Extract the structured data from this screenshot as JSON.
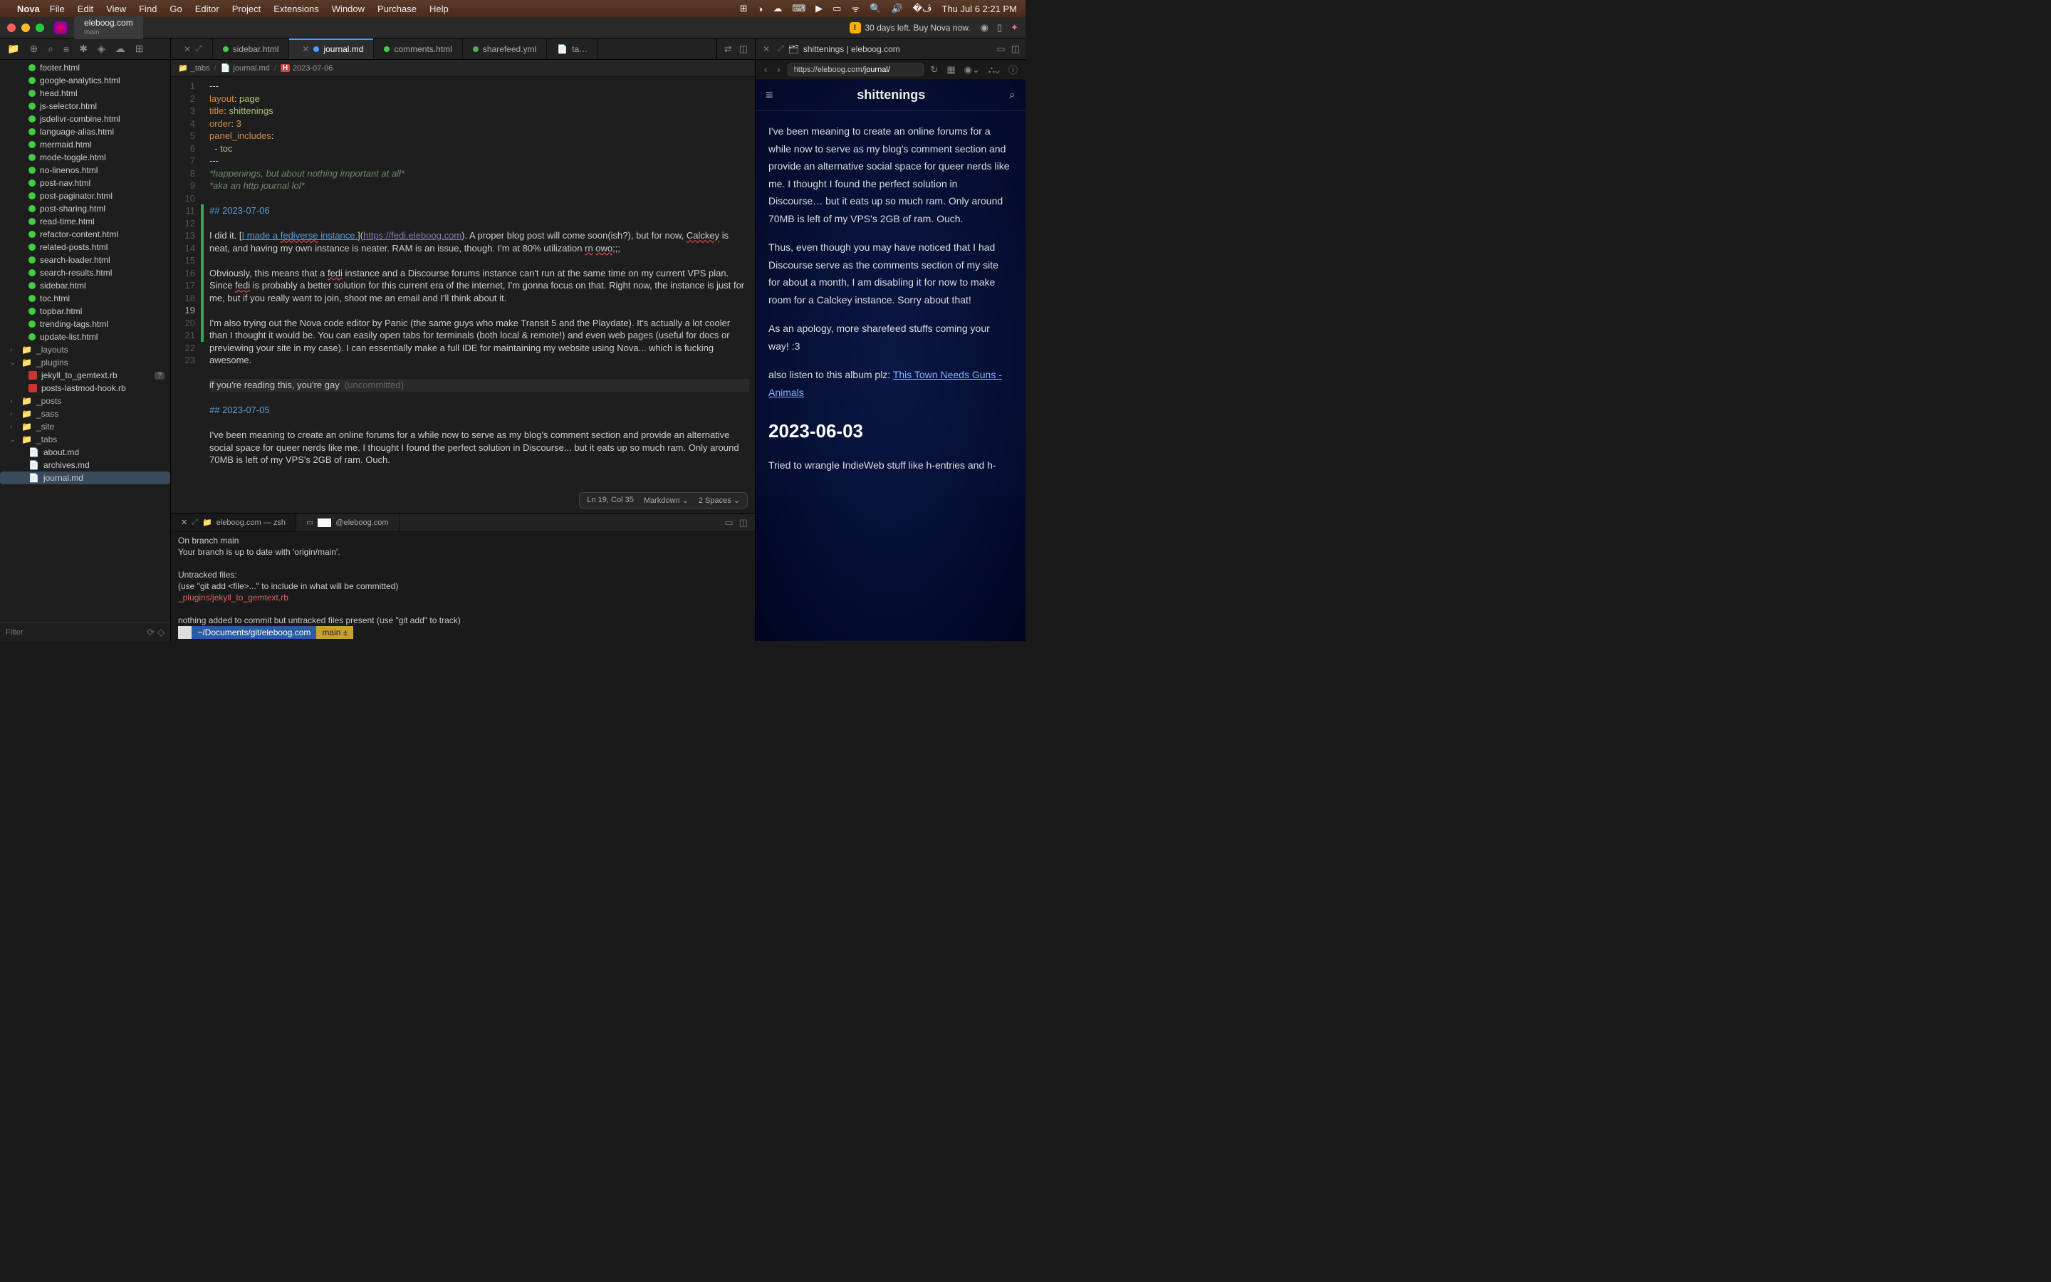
{
  "menubar": {
    "app": "Nova",
    "items": [
      "File",
      "Edit",
      "View",
      "Find",
      "Go",
      "Editor",
      "Project",
      "Extensions",
      "Window",
      "Purchase",
      "Help"
    ],
    "clock": "Thu Jul 6  2:21 PM"
  },
  "titlebar": {
    "project": "eleboog.com",
    "branch": "main",
    "trial": "30 days left. Buy Nova now."
  },
  "tabs": [
    {
      "label": "sidebar.html",
      "icon": "green"
    },
    {
      "label": "journal.md",
      "icon": "blue",
      "active": true,
      "close": true
    },
    {
      "label": "comments.html",
      "icon": "green"
    },
    {
      "label": "sharefeed.yml",
      "icon": "green-alt"
    },
    {
      "label": "ta…",
      "icon": "doc"
    }
  ],
  "preview_tab": {
    "label": "shittenings | eleboog.com"
  },
  "breadcrumb": {
    "segs": [
      "_tabs",
      "journal.md"
    ],
    "heading": "2023-07-06"
  },
  "sidebar_files": [
    "footer.html",
    "google-analytics.html",
    "head.html",
    "js-selector.html",
    "jsdelivr-combine.html",
    "language-alias.html",
    "mermaid.html",
    "mode-toggle.html",
    "no-linenos.html",
    "post-nav.html",
    "post-paginator.html",
    "post-sharing.html",
    "read-time.html",
    "refactor-content.html",
    "related-posts.html",
    "search-loader.html",
    "search-results.html",
    "sidebar.html",
    "toc.html",
    "topbar.html",
    "trending-tags.html",
    "update-list.html"
  ],
  "sidebar_folders": [
    {
      "name": "_layouts",
      "open": false
    },
    {
      "name": "_plugins",
      "open": true,
      "children": [
        {
          "name": "jekyll_to_gemtext.rb",
          "badge": "?"
        },
        {
          "name": "posts-lastmod-hook.rb"
        }
      ]
    },
    {
      "name": "_posts",
      "open": false
    },
    {
      "name": "_sass",
      "open": false
    },
    {
      "name": "_site",
      "open": false
    },
    {
      "name": "_tabs",
      "open": true,
      "children": [
        {
          "name": "about.md"
        },
        {
          "name": "archives.md"
        },
        {
          "name": "journal.md",
          "selected": true
        }
      ]
    }
  ],
  "filter_placeholder": "Filter",
  "editor": {
    "lines": [
      {
        "n": 1,
        "html": "---"
      },
      {
        "n": 2,
        "html": "<span class='kw'>layout</span>: <span class='str'>page</span>"
      },
      {
        "n": 3,
        "html": "<span class='kw'>title</span>: <span class='str'>shittenings</span>"
      },
      {
        "n": 4,
        "html": "<span class='kw'>order</span>: <span class='num'>3</span>"
      },
      {
        "n": 5,
        "html": "<span class='kw'>panel_includes</span>:"
      },
      {
        "n": 6,
        "html": "  - <span class='str'>toc</span>"
      },
      {
        "n": 7,
        "html": "---"
      },
      {
        "n": 8,
        "html": "<span class='cmt'>*happenings, but about nothing important at all*</span>"
      },
      {
        "n": 9,
        "html": "<span class='cmt'>*aka an http journal lol*</span>"
      },
      {
        "n": 10,
        "html": ""
      },
      {
        "n": 11,
        "html": "<span class='hdr'>## 2023-07-06</span>",
        "mod": true
      },
      {
        "n": 12,
        "html": "",
        "mod": true
      },
      {
        "n": 13,
        "html": "I did it. [<span class='lnk'>I made a <span class='spell'>fediverse</span> instance.</span>](<span class='url'>https://fedi.eleboog.com</span>). A proper blog post will come soon(ish?), but for now, <span class='spell'>Calckey</span> is neat, and having my own instance is neater. RAM is an issue, though. I'm at 80% utilization <span class='spell'>rn</span> <span class='spell'>owo</span>;;;",
        "mod": true
      },
      {
        "n": 14,
        "html": "",
        "mod": true
      },
      {
        "n": 15,
        "html": "Obviously, this means that a <span class='spell'>fedi</span> instance and a Discourse forums instance can't run at the same time on my current VPS plan. Since <span class='spell'>fedi</span> is probably a better solution for this current era of the internet, I'm gonna focus on that. Right now, the instance is just for me, but if you really want to join, shoot me an email and I'll think about it.",
        "mod": true
      },
      {
        "n": 16,
        "html": "",
        "mod": true
      },
      {
        "n": 17,
        "html": "I'm also trying out the Nova code editor by Panic (the same guys who make Transit 5 and the Playdate). It's actually a lot cooler than I thought it would be. You can easily open tabs for terminals (both local &amp; remote!) and even web pages (useful for docs or previewing your site in my case). I can essentially make a full IDE for maintaining my website using Nova... which is fucking awesome.",
        "mod": true
      },
      {
        "n": 18,
        "html": "",
        "mod": true
      },
      {
        "n": 19,
        "html": "if you're reading this, you're gay  <span class='uncommitted'>(uncommitted)</span>",
        "mod": true,
        "cur": true
      },
      {
        "n": 20,
        "html": "",
        "mod": true
      },
      {
        "n": 21,
        "html": "<span class='hdr'>## 2023-07-05</span>",
        "mod": true
      },
      {
        "n": 22,
        "html": ""
      },
      {
        "n": 23,
        "html": "I've been meaning to create an online forums for a while now to serve as my blog's comment section and provide an alternative social space for queer nerds like me. I thought I found the perfect solution in Discourse... but it eats up so much ram. Only around 70MB is left of my VPS's 2GB of ram. Ouch."
      }
    ]
  },
  "statusbar": {
    "pos": "Ln 19, Col 35",
    "lang": "Markdown",
    "indent": "2 Spaces"
  },
  "terminal": {
    "tabs": [
      {
        "label": "eleboog.com — zsh",
        "active": true
      },
      {
        "label": "@eleboog.com"
      }
    ],
    "lines": [
      "On branch main",
      "Your branch is up to date with 'origin/main'.",
      "",
      "Untracked files:",
      "  (use \"git add <file>...\" to include in what will be committed)",
      {
        "text": "        _plugins/jekyll_to_gemtext.rb",
        "cls": "tred"
      },
      "",
      "nothing added to commit but untracked files present (use \"git add\" to track)"
    ],
    "prompt": {
      "path": "~/Documents/git/eleboog.com",
      "branch": "main ±"
    }
  },
  "preview": {
    "url_host": "https://eleboog.com/",
    "url_path": "journal/",
    "page_title": "shittenings",
    "paras": [
      "I've been meaning to create an online forums for a while now to serve as my blog's comment section and provide an alternative social space for queer nerds like me. I thought I found the perfect solution in Discourse… but it eats up so much ram. Only around 70MB is left of my VPS's 2GB of ram. Ouch.",
      "Thus, even though you may have noticed that I had Discourse serve as the comments section of my site for about a month, I am disabling it for now to make room for a Calckey instance. Sorry about that!",
      "As an apology, more sharefeed stuffs coming your way! :3"
    ],
    "link_pre": "also listen to this album plz: ",
    "link_text": "This Town Needs Guns - Animals",
    "h2": "2023-06-03",
    "trail": "Tried to wrangle IndieWeb stuff like h-entries and h-"
  }
}
